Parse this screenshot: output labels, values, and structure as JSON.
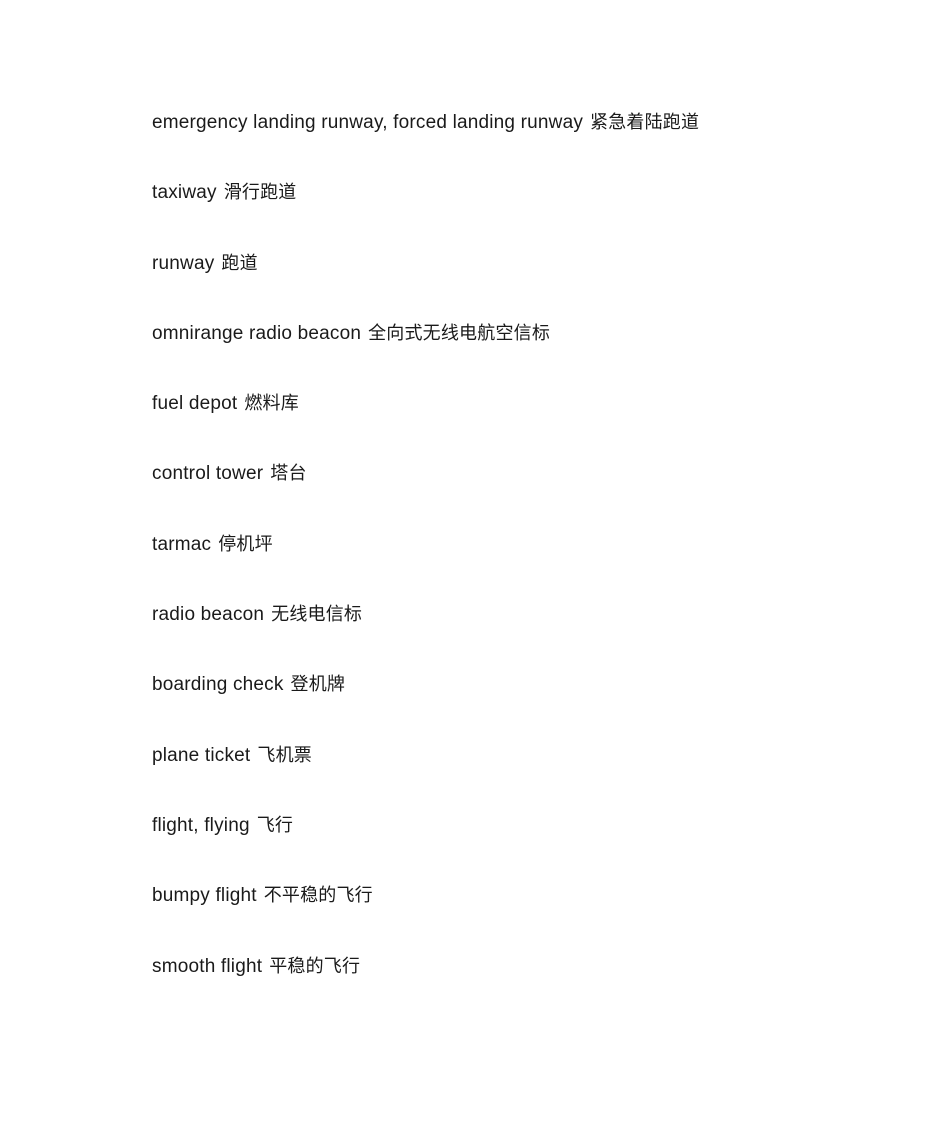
{
  "document": {
    "background_color": "#ffffff",
    "text_color": "#1a1a1a",
    "entries": [
      {
        "term": "emergency landing runway, forced landing runway",
        "gloss": "紧急着陆跑道"
      },
      {
        "term": "taxiway",
        "gloss": "滑行跑道"
      },
      {
        "term": "runway",
        "gloss": "跑道"
      },
      {
        "term": "omnirange radio beacon",
        "gloss": "全向式无线电航空信标"
      },
      {
        "term": "fuel depot",
        "gloss": "燃料库"
      },
      {
        "term": "control tower",
        "gloss": "塔台"
      },
      {
        "term": "tarmac",
        "gloss": "停机坪"
      },
      {
        "term": "radio beacon",
        "gloss": "无线电信标"
      },
      {
        "term": "boarding check",
        "gloss": "登机牌"
      },
      {
        "term": "plane ticket",
        "gloss": "飞机票"
      },
      {
        "term": "flight, flying",
        "gloss": "飞行"
      },
      {
        "term": "bumpy flight",
        "gloss": "不平稳的飞行"
      },
      {
        "term": "smooth flight",
        "gloss": "平稳的飞行"
      }
    ]
  }
}
